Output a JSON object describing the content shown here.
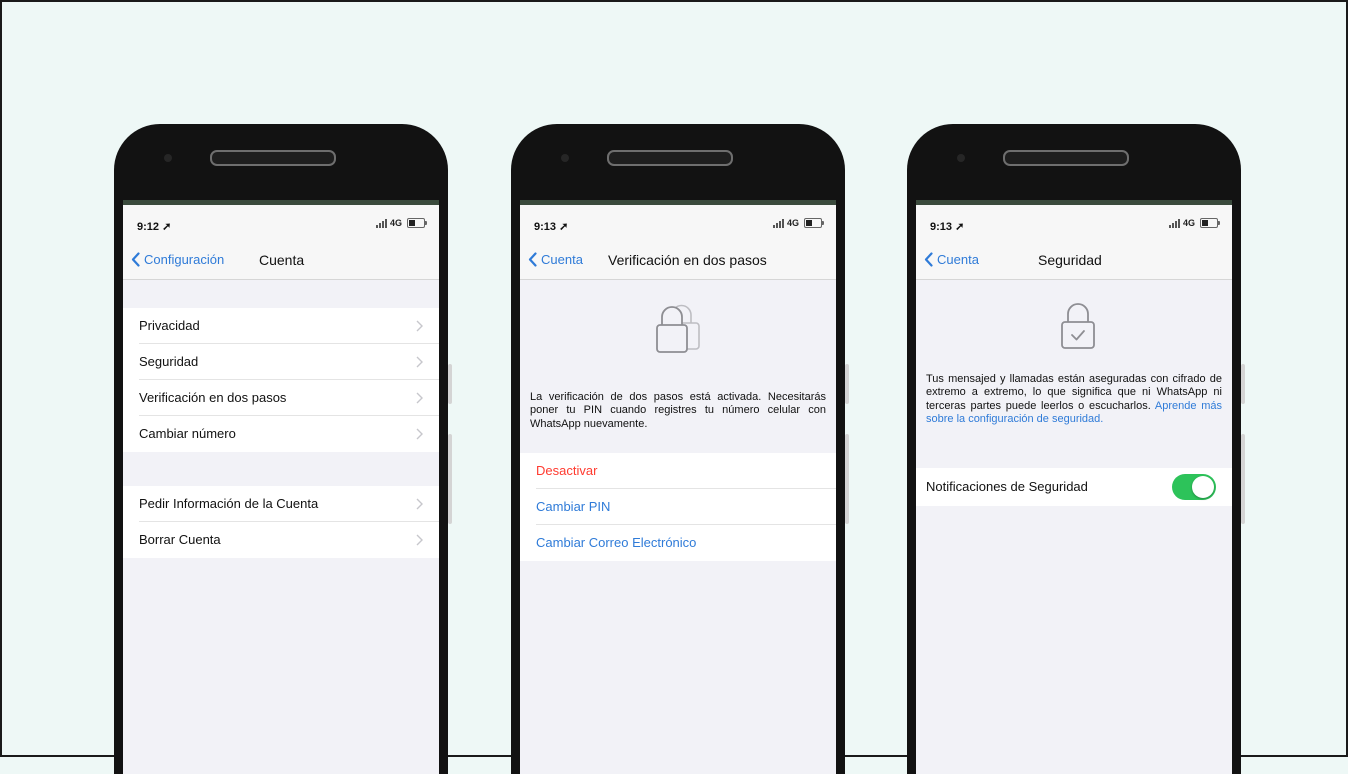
{
  "phones": [
    {
      "time": "9:12",
      "network": "4G",
      "back_label": "Configuración",
      "title": "Cuenta",
      "group1": [
        "Privacidad",
        "Seguridad",
        "Verificación en dos pasos",
        "Cambiar número"
      ],
      "group2": [
        "Pedir Información de la Cuenta",
        "Borrar Cuenta"
      ]
    },
    {
      "time": "9:13",
      "network": "4G",
      "back_label": "Cuenta",
      "title": "Verificación en dos pasos",
      "description": "La verificación de dos pasos está activada. Necesitarás poner tu PIN cuando registres tu número celular con WhatsApp nuevamente.",
      "actions": {
        "disable": "Desactivar",
        "change_pin": "Cambiar PIN",
        "change_email": "Cambiar Correo Electrónico"
      }
    },
    {
      "time": "9:13",
      "network": "4G",
      "back_label": "Cuenta",
      "title": "Seguridad",
      "description": "Tus mensajed y llamadas están aseguradas con cifrado de extremo a extremo, lo que significa que ni WhatsApp ni terceras partes puede leerlos o escucharlos.",
      "learn_more": "Aprende más sobre la configuración de seguridad.",
      "notifications_label": "Notificaciones de Seguridad",
      "notifications_enabled": true
    }
  ],
  "colors": {
    "background": "#eef8f6",
    "ios_blue": "#2f7bd8",
    "destructive_red": "#ff3b30",
    "toggle_green": "#2dc35a",
    "phone_body": "#121212"
  }
}
